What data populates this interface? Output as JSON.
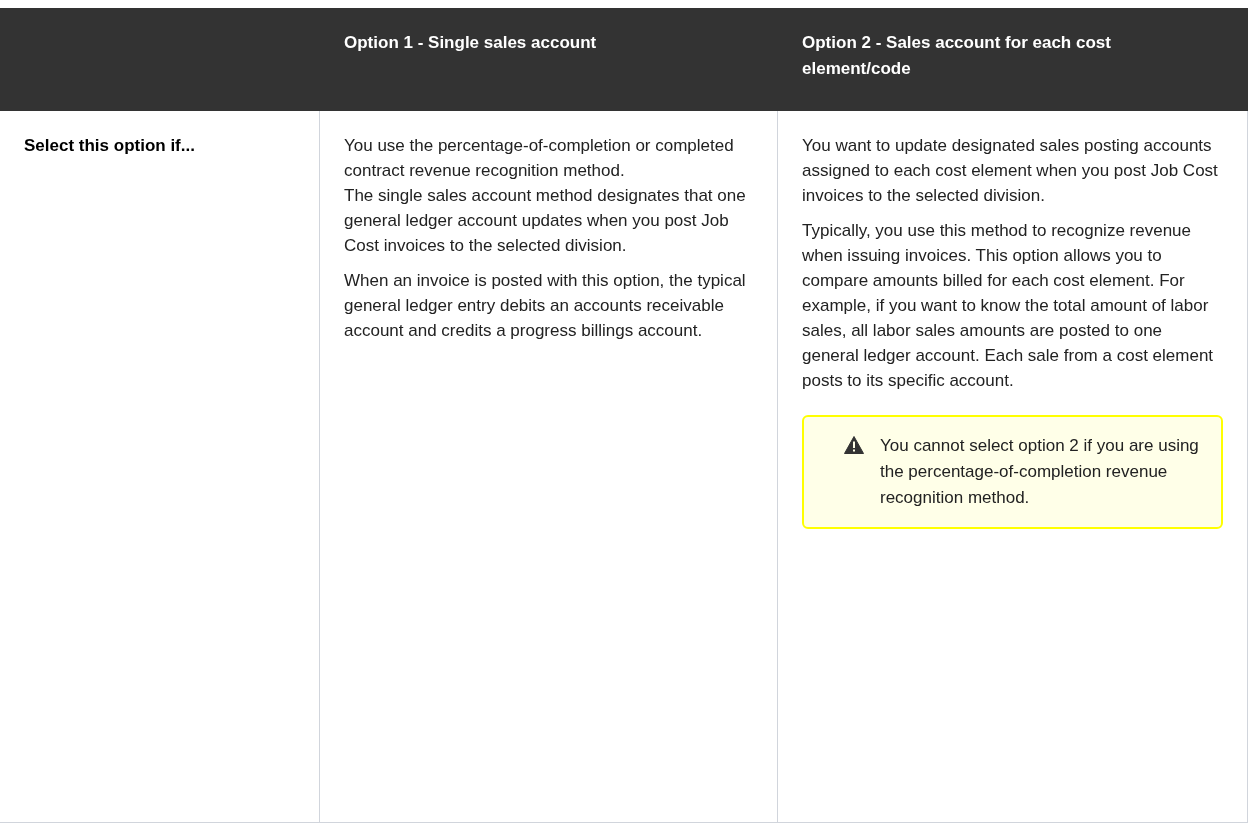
{
  "table": {
    "columns": [
      {
        "label": "Option 1 - Single sales account"
      },
      {
        "label": "Option 2 - Sales account for each cost element/code"
      }
    ],
    "rows": [
      {
        "label": "Select this option if...",
        "cells": [
          {
            "paragraphs": [
              "You use the percentage-of-completion or completed contract revenue recognition method.\nThe single sales account method designates that one general ledger account updates when you post Job Cost invoices to the selected division.",
              "When an invoice is posted with this option, the typical general ledger entry debits an accounts receivable account and credits a progress billings account."
            ]
          },
          {
            "paragraphs": [
              "You want to update designated sales posting accounts assigned to each cost element when you post Job Cost invoices to the selected division.",
              "Typically, you use this method to recognize revenue when issuing invoices. This option allows you to compare amounts billed for each cost element. For example, if you want to know the total amount of labor sales, all labor sales amounts are posted to one general ledger account. Each sale from a cost element posts to its specific account."
            ],
            "note": {
              "kind": "warning",
              "text": "You cannot select option 2 if you are using the percentage-of-completion revenue recognition method."
            }
          }
        ]
      }
    ]
  }
}
